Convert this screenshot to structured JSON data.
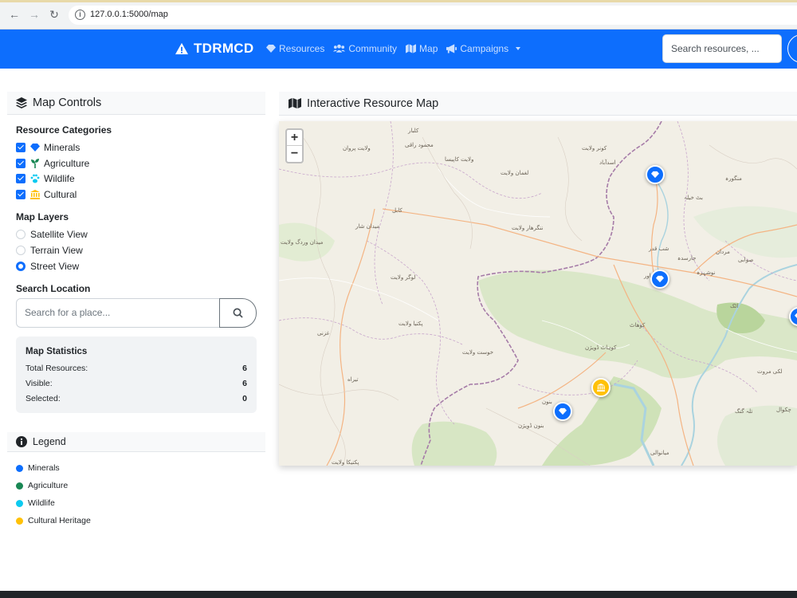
{
  "browser": {
    "url": "127.0.0.1:5000/map"
  },
  "navbar": {
    "brand": "TDRMCD",
    "links": [
      {
        "label": "Resources",
        "icon": "gem-icon"
      },
      {
        "label": "Community",
        "icon": "users-icon"
      },
      {
        "label": "Map",
        "icon": "map-icon"
      },
      {
        "label": "Campaigns",
        "icon": "bullhorn-icon"
      }
    ],
    "search_placeholder": "Search resources, ..."
  },
  "controls": {
    "title": "Map Controls",
    "categories_title": "Resource Categories",
    "categories": [
      {
        "label": "Minerals",
        "checked": true,
        "color": "#0d6efd"
      },
      {
        "label": "Agriculture",
        "checked": true,
        "color": "#198754"
      },
      {
        "label": "Wildlife",
        "checked": true,
        "color": "#0dcaf0"
      },
      {
        "label": "Cultural",
        "checked": true,
        "color": "#ffc107"
      }
    ],
    "layers_title": "Map Layers",
    "layers": [
      {
        "label": "Satellite View",
        "checked": false
      },
      {
        "label": "Terrain View",
        "checked": false
      },
      {
        "label": "Street View",
        "checked": true
      }
    ],
    "search_title": "Search Location",
    "search_placeholder": "Search for a place..."
  },
  "stats": {
    "title": "Map Statistics",
    "rows": [
      {
        "label": "Total Resources:",
        "value": "6"
      },
      {
        "label": "Visible:",
        "value": "6"
      },
      {
        "label": "Selected:",
        "value": "0"
      }
    ]
  },
  "legend": {
    "title": "Legend",
    "items": [
      {
        "label": "Minerals",
        "color": "#0d6efd"
      },
      {
        "label": "Agriculture",
        "color": "#198754"
      },
      {
        "label": "Wildlife",
        "color": "#0dcaf0"
      },
      {
        "label": "Cultural Heritage",
        "color": "#ffc107"
      }
    ]
  },
  "map": {
    "title": "Interactive Resource Map",
    "zoom_in": "+",
    "zoom_out": "−",
    "labels": [
      "ولایت پروان",
      "کلبار",
      "محمود راقی",
      "ولایت کاپیسا",
      "کونر ولایت",
      "اسدآباد",
      "لغمان ولایت",
      "کابل",
      "میدان شار",
      "ننگرهار ولایت",
      "لوگر ولایت",
      "پکتیا ولایت",
      "خوست ولایت",
      "پکتیکا ولایت",
      "بنون",
      "کوهاٹ",
      "پشاور",
      "نوشہرہ",
      "مردان",
      "صوابی",
      "اٹک",
      "میانوالی",
      "غزنی",
      "میدان وردگ ولایت",
      "ولایت لوگر",
      "تیراه",
      "لکی مروت",
      "بنون ڈویژن",
      "منگورہ",
      "بٹ خیلہ",
      "شب قدر",
      "چارسدہ",
      "کوہاٹ ڈویژن",
      "تلہ گنگ",
      "چکوال"
    ],
    "markers": [
      {
        "type": "mineral",
        "color": "#0d6efd",
        "icon": "gem-icon"
      },
      {
        "type": "mineral",
        "color": "#0d6efd",
        "icon": "gem-icon"
      },
      {
        "type": "mineral",
        "color": "#0d6efd",
        "icon": "gem-icon"
      },
      {
        "type": "mineral",
        "color": "#0d6efd",
        "icon": "gem-icon"
      },
      {
        "type": "cultural",
        "color": "#ffc107",
        "icon": "landmark-icon"
      }
    ]
  }
}
